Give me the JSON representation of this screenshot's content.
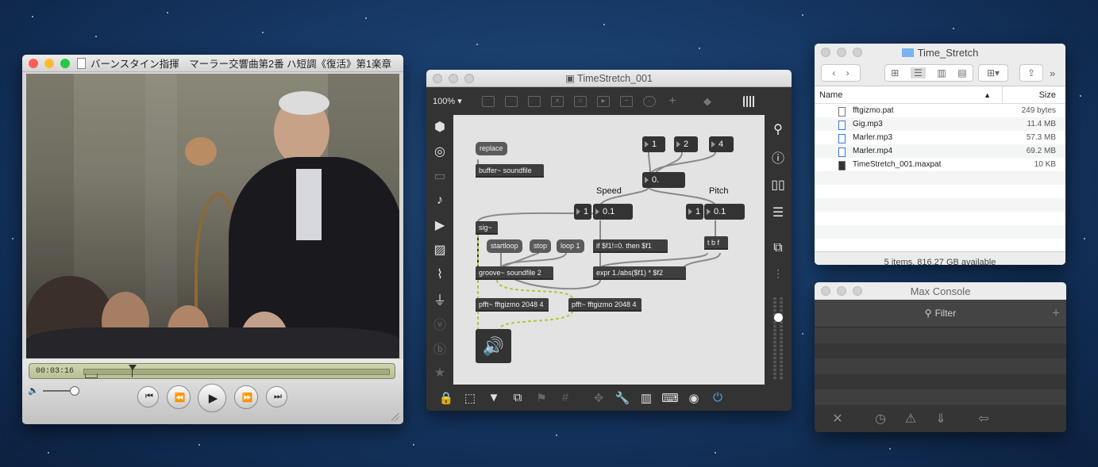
{
  "quicktime": {
    "title": "バーンスタイン指揮　マーラー交響曲第2番 ハ短調《復活》第1楽章",
    "time": "00:03:16",
    "buttons": [
      "⏮",
      "⏪",
      "▶",
      "⏩",
      "⏭"
    ]
  },
  "max_patcher": {
    "title": "TimeStretch_001",
    "zoom": "100%",
    "objects": {
      "replace": "replace",
      "buffer": "buffer~ soundfile",
      "sig": "sig~",
      "startloop": "startloop",
      "stop": "stop",
      "loop": "loop 1",
      "groove": "groove~ soundfile 2",
      "pfft1": "pfft~ fftgizmo 2048 4",
      "pfft2": "pfft~ fftgizmo 2048 4",
      "if": "if $f1!=0. then $f1",
      "expr": "expr 1./abs($f1) * $f2",
      "tbf": "t b f",
      "msg1": "1",
      "msg2": "2",
      "msg4": "4",
      "num_main": "0.",
      "num_speed_int": "1",
      "num_speed": "0.1",
      "num_pitch_int": "1",
      "num_pitch": "0.1",
      "speed_label": "Speed",
      "pitch_label": "Pitch"
    }
  },
  "finder": {
    "title": "Time_Stretch",
    "col_name": "Name",
    "col_size": "Size",
    "files": [
      {
        "name": "fftgizmo.pat",
        "size": "249 bytes"
      },
      {
        "name": "Gig.mp3",
        "size": "11.4 MB"
      },
      {
        "name": "Marler.mp3",
        "size": "57.3 MB"
      },
      {
        "name": "Marler.mp4",
        "size": "69.2 MB"
      },
      {
        "name": "TimeStretch_001.maxpat",
        "size": "10 KB"
      }
    ],
    "status": "5 items, 816.27 GB available"
  },
  "console": {
    "title": "Max Console",
    "filter": "Filter"
  },
  "colors": {
    "close": "#fc5f57",
    "minimize": "#fdbc2e",
    "zoom": "#28c840",
    "cable_signal": "#b5c43a",
    "cable_control": "#8a8a8a"
  }
}
